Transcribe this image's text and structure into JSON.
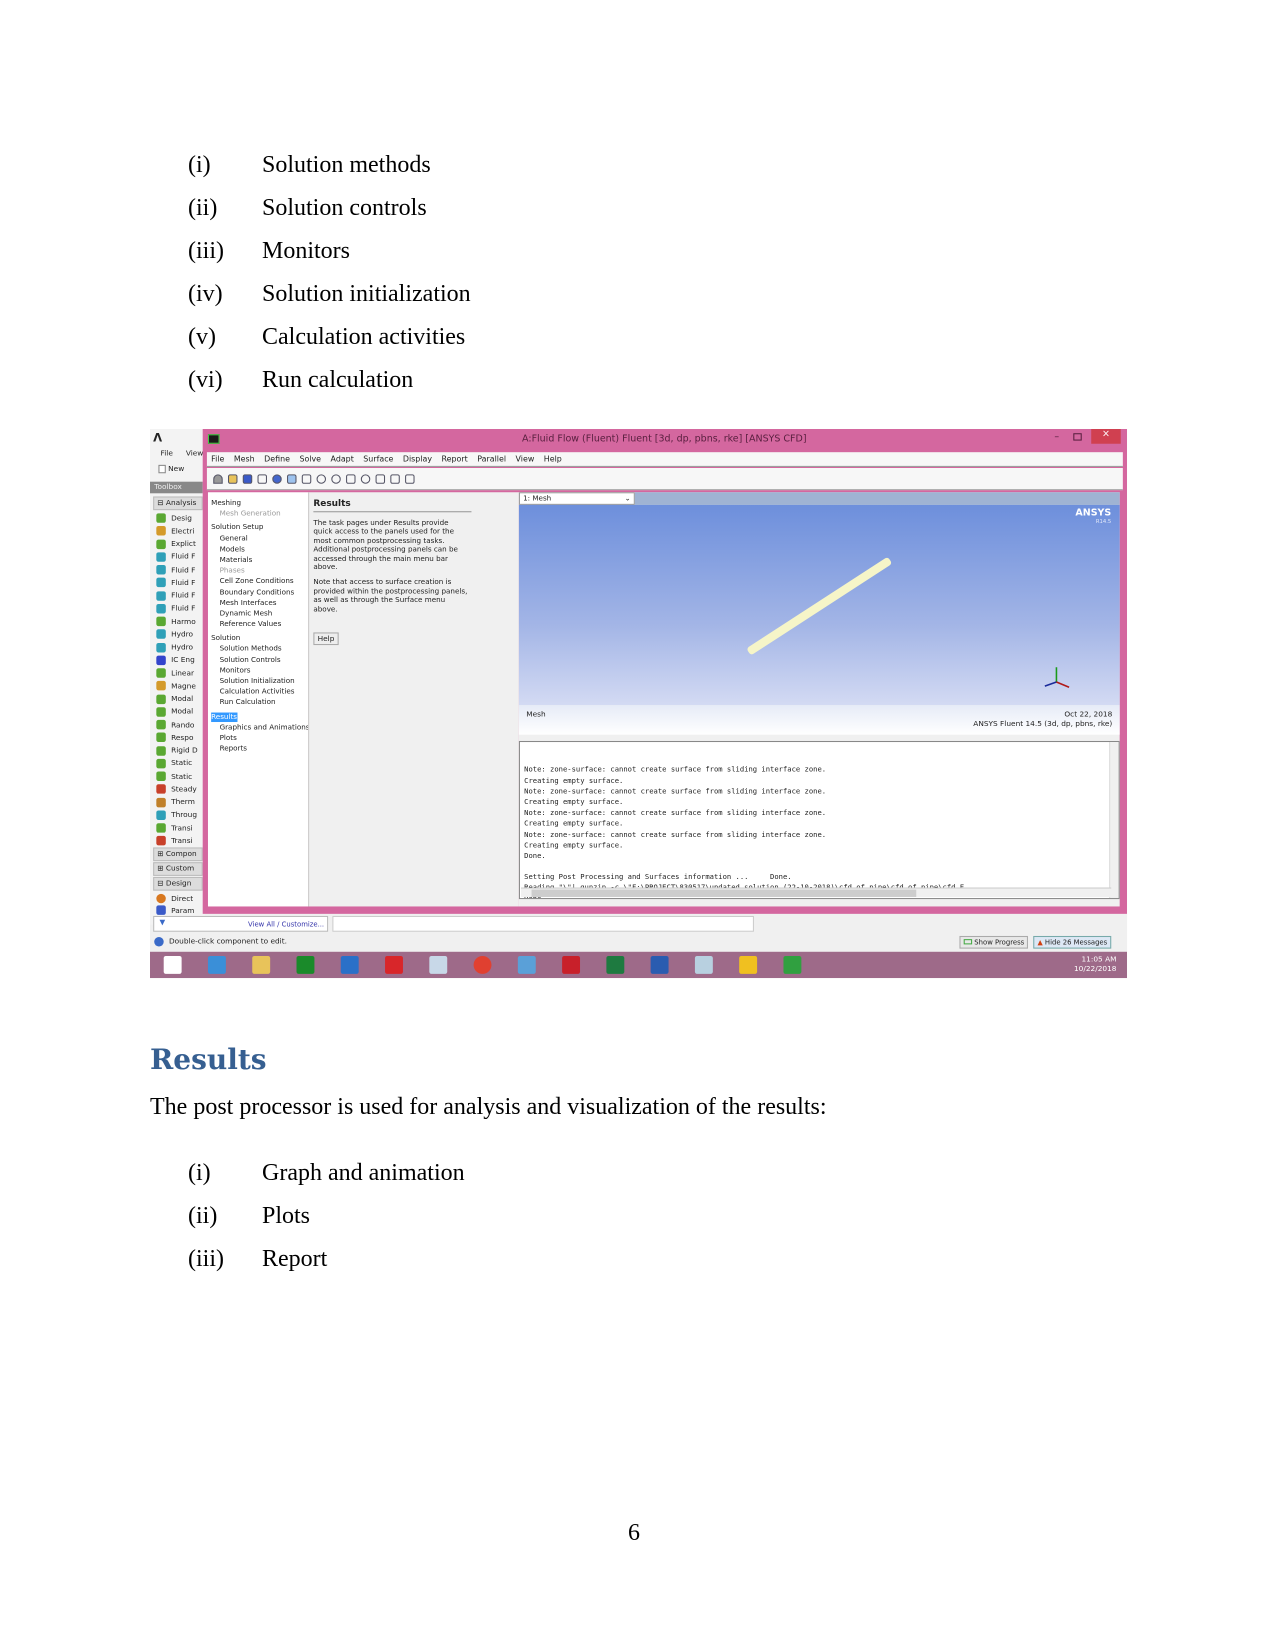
{
  "list1": [
    {
      "num": "(i)",
      "text": "Solution methods"
    },
    {
      "num": "(ii)",
      "text": "Solution controls"
    },
    {
      "num": "(iii)",
      "text": "Monitors"
    },
    {
      "num": "(iv)",
      "text": "Solution initialization"
    },
    {
      "num": "(v)",
      "text": "Calculation activities"
    },
    {
      "num": "(vi)",
      "text": "Run calculation"
    }
  ],
  "screenshot": {
    "workbench": {
      "menu": [
        "File",
        "View"
      ],
      "new_label": "New",
      "toolbox_label": "Toolbox",
      "analysis_group": "Analysis",
      "items": [
        {
          "label": "Desig",
          "color": "#5aa832"
        },
        {
          "label": "Electri",
          "color": "#d49a2a"
        },
        {
          "label": "Explict",
          "color": "#5aa832"
        },
        {
          "label": "Fluid F",
          "color": "#2fa0b8"
        },
        {
          "label": "Fluid F",
          "color": "#2fa0b8"
        },
        {
          "label": "Fluid F",
          "color": "#2fa0b8"
        },
        {
          "label": "Fluid F",
          "color": "#2fa0b8"
        },
        {
          "label": "Fluid F",
          "color": "#2fa0b8"
        },
        {
          "label": "Harmo",
          "color": "#5aa832"
        },
        {
          "label": "Hydro",
          "color": "#2fa0b8"
        },
        {
          "label": "Hydro",
          "color": "#2fa0b8"
        },
        {
          "label": "IC Eng",
          "color": "#3344cc"
        },
        {
          "label": "Linear",
          "color": "#5aa832"
        },
        {
          "label": "Magne",
          "color": "#d49a2a"
        },
        {
          "label": "Modal",
          "color": "#5aa832"
        },
        {
          "label": "Modal",
          "color": "#5aa832"
        },
        {
          "label": "Rando",
          "color": "#5aa832"
        },
        {
          "label": "Respo",
          "color": "#5aa832"
        },
        {
          "label": "Rigid D",
          "color": "#5aa832"
        },
        {
          "label": "Static",
          "color": "#5aa832"
        },
        {
          "label": "Static",
          "color": "#5aa832"
        },
        {
          "label": "Steady",
          "color": "#c8402a"
        },
        {
          "label": "Therm",
          "color": "#c0802a"
        },
        {
          "label": "Throug",
          "color": "#2fa0b8"
        },
        {
          "label": "Transi",
          "color": "#5aa832"
        },
        {
          "label": "Transi",
          "color": "#c8402a"
        }
      ],
      "groups": [
        "Compon",
        "Custom",
        "Design"
      ],
      "extra_items": [
        "Direct",
        "Param"
      ],
      "view_all": "View All / Customize...",
      "status": "Double-click component to edit.",
      "show_progress": "Show Progress",
      "hide_messages": "Hide 26 Messages"
    },
    "fluent": {
      "title": "A:Fluid Flow (Fluent) Fluent  [3d, dp, pbns, rke] [ANSYS CFD]",
      "menu": [
        "File",
        "Mesh",
        "Define",
        "Solve",
        "Adapt",
        "Surface",
        "Display",
        "Report",
        "Parallel",
        "View",
        "Help"
      ],
      "tree": [
        {
          "label": "Meshing",
          "kind": "hdr"
        },
        {
          "label": "Mesh Generation",
          "kind": "dim"
        },
        {
          "label": "Solution Setup",
          "kind": "hdr"
        },
        {
          "label": "General",
          "kind": "sub"
        },
        {
          "label": "Models",
          "kind": "sub"
        },
        {
          "label": "Materials",
          "kind": "sub"
        },
        {
          "label": "Phases",
          "kind": "dim"
        },
        {
          "label": "Cell Zone Conditions",
          "kind": "sub"
        },
        {
          "label": "Boundary Conditions",
          "kind": "sub"
        },
        {
          "label": "Mesh Interfaces",
          "kind": "sub"
        },
        {
          "label": "Dynamic Mesh",
          "kind": "sub"
        },
        {
          "label": "Reference Values",
          "kind": "sub"
        },
        {
          "label": "Solution",
          "kind": "hdr"
        },
        {
          "label": "Solution Methods",
          "kind": "sub"
        },
        {
          "label": "Solution Controls",
          "kind": "sub"
        },
        {
          "label": "Monitors",
          "kind": "sub"
        },
        {
          "label": "Solution Initialization",
          "kind": "sub"
        },
        {
          "label": "Calculation Activities",
          "kind": "sub"
        },
        {
          "label": "Run Calculation",
          "kind": "sub"
        },
        {
          "label": "Results",
          "kind": "sel"
        },
        {
          "label": "Graphics and Animations",
          "kind": "sub"
        },
        {
          "label": "Plots",
          "kind": "sub"
        },
        {
          "label": "Reports",
          "kind": "sub"
        }
      ],
      "task": {
        "heading": "Results",
        "p1": "The task pages under Results provide quick access to the panels used for the most common postprocessing tasks. Additional postprocessing panels can be accessed through the main menu bar above.",
        "p2": "Note that access to surface creation is provided within the postprocessing panels, as well as through the Surface menu above.",
        "help": "Help"
      },
      "graphics": {
        "dropdown": "1: Mesh",
        "logo": "ANSYS",
        "logo_sub": "R14.5",
        "caption_left": "Mesh",
        "date": "Oct 22, 2018",
        "version": "ANSYS Fluent 14.5 (3d, dp, pbns, rke)"
      },
      "console": [
        "Note: zone-surface: cannot create surface from sliding interface zone.",
        "Creating empty surface.",
        "Note: zone-surface: cannot create surface from sliding interface zone.",
        "Creating empty surface.",
        "Note: zone-surface: cannot create surface from sliding interface zone.",
        "Creating empty surface.",
        "Note: zone-surface: cannot create surface from sliding interface zone.",
        "Creating empty surface.",
        "Done.",
        "",
        "Setting Post Processing and Surfaces information ...     Done.",
        "Reading \"\\\"| gunzip -c \\\"F:\\PROJECT\\830517\\updated solution (22-10-2018)\\cfd_of pipe\\cfd_of pipe\\cfd_F",
        "Done."
      ]
    },
    "taskbar": {
      "apps": [
        {
          "name": "windows-start",
          "color": "#ffffff"
        },
        {
          "name": "internet-explorer",
          "color": "#3a8fd8"
        },
        {
          "name": "file-explorer",
          "color": "#e8c35a"
        },
        {
          "name": "store",
          "color": "#1a8a2a"
        },
        {
          "name": "app-window",
          "color": "#2a70c8"
        },
        {
          "name": "solidworks",
          "color": "#d8262a"
        },
        {
          "name": "calculator",
          "color": "#c8d8e8"
        },
        {
          "name": "chrome",
          "color": "#e04030"
        },
        {
          "name": "photos",
          "color": "#5aa0d8"
        },
        {
          "name": "acrobat",
          "color": "#c8202a"
        },
        {
          "name": "excel",
          "color": "#1e7a40"
        },
        {
          "name": "word",
          "color": "#2a5cb0"
        },
        {
          "name": "notes",
          "color": "#b8d0e0"
        },
        {
          "name": "ansys-workbench",
          "color": "#f0c020"
        },
        {
          "name": "fluent",
          "color": "#30a040"
        }
      ],
      "time": "11:05 AM",
      "date": "10/22/2018"
    }
  },
  "results_heading": "Results",
  "results_para": "The post processor is used for analysis and visualization of the results:",
  "list2": [
    {
      "num": "(i)",
      "text": "Graph and animation"
    },
    {
      "num": "(ii)",
      "text": "Plots"
    },
    {
      "num": "(iii)",
      "text": "Report"
    }
  ],
  "page_number": "6"
}
